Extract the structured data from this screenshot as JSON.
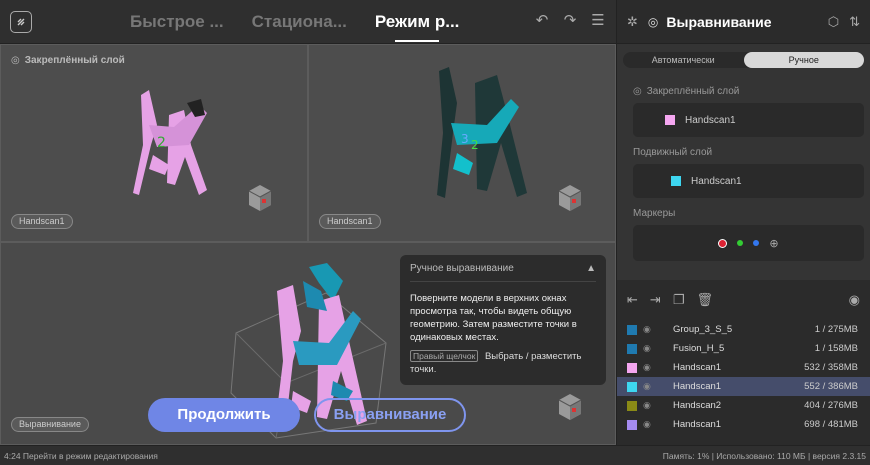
{
  "tabs": [
    "Быстрое ...",
    "Стациона...",
    "Режим р..."
  ],
  "viewports": {
    "fixed_title": "Закреплённый слой",
    "vp1_label": "Handscan1",
    "vp2_label": "Handscan1",
    "vp3_label": "Выравнивание"
  },
  "panel": {
    "title": "Ручное выравнивание",
    "text": "Поверните модели в верхних окнах просмотра так, чтобы видеть общую геометрию. Затем разместите точки в одинаковых местах.",
    "key": "Правый щелчок",
    "action": "Выбрать / разместить точки."
  },
  "buttons": {
    "continue": "Продолжить",
    "align": "Выравнивание"
  },
  "right": {
    "title": "Выравнивание",
    "mode_auto": "Автоматически",
    "mode_manual": "Ручное",
    "fixed_label": "Закреплённый слой",
    "fixed_value": "Handscan1",
    "moving_label": "Подвижный слой",
    "moving_value": "Handscan1",
    "markers_label": "Маркеры"
  },
  "files": [
    {
      "name": "Group_3_S_5",
      "size": "1 / 275MB",
      "color": "#1f7ab0",
      "selected": false
    },
    {
      "name": "Fusion_H_5",
      "size": "1 / 158MB",
      "color": "#1f7ab0",
      "selected": false
    },
    {
      "name": "Handscan1",
      "size": "532 / 358MB",
      "color": "#f4a6f0",
      "selected": false
    },
    {
      "name": "Handscan1",
      "size": "552 / 386MB",
      "color": "#3ed6f0",
      "selected": true
    },
    {
      "name": "Handscan2",
      "size": "404 / 276MB",
      "color": "#8a8a16",
      "selected": false
    },
    {
      "name": "Handscan1",
      "size": "698 / 481MB",
      "color": "#a58bf0",
      "selected": false
    }
  ],
  "status": {
    "left": "4:24 Перейти в режим редактирования",
    "right": "Память: 1% | Использовано: 110 МБ | версия 2.3.15"
  }
}
